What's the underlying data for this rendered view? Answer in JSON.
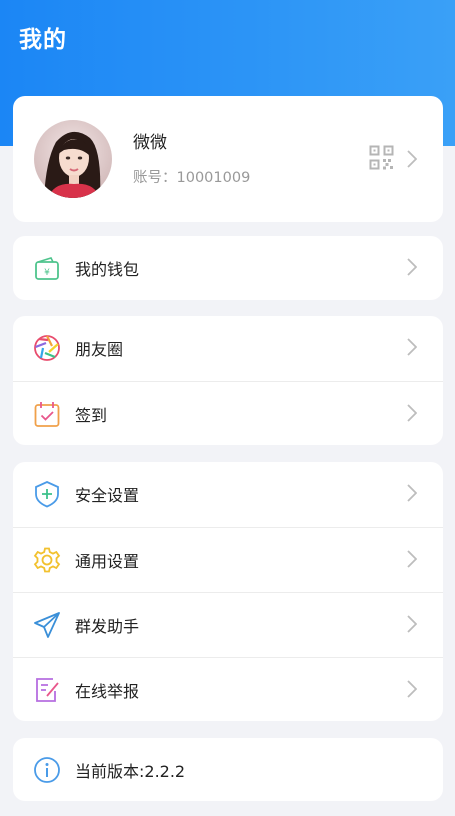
{
  "header": {
    "title": "我的"
  },
  "profile": {
    "name": "微微",
    "account": "账号：10001009"
  },
  "menu": {
    "wallet": "我的钱包",
    "moments": "朋友圈",
    "checkin": "签到",
    "security": "安全设置",
    "general": "通用设置",
    "broadcast": "群发助手",
    "report": "在线举报",
    "version": "当前版本:2.2.2"
  },
  "icons": {
    "qr": "qr-code-icon",
    "chevron": "chevron-right-icon",
    "wallet": "wallet-icon",
    "moments": "aperture-icon",
    "checkin": "calendar-check-icon",
    "security": "shield-plus-icon",
    "general": "gear-icon",
    "broadcast": "paper-plane-icon",
    "report": "edit-document-icon",
    "version": "info-icon"
  },
  "colors": {
    "header_start": "#1b86f5",
    "header_end": "#3aa0f7",
    "background": "#f2f3f7"
  }
}
